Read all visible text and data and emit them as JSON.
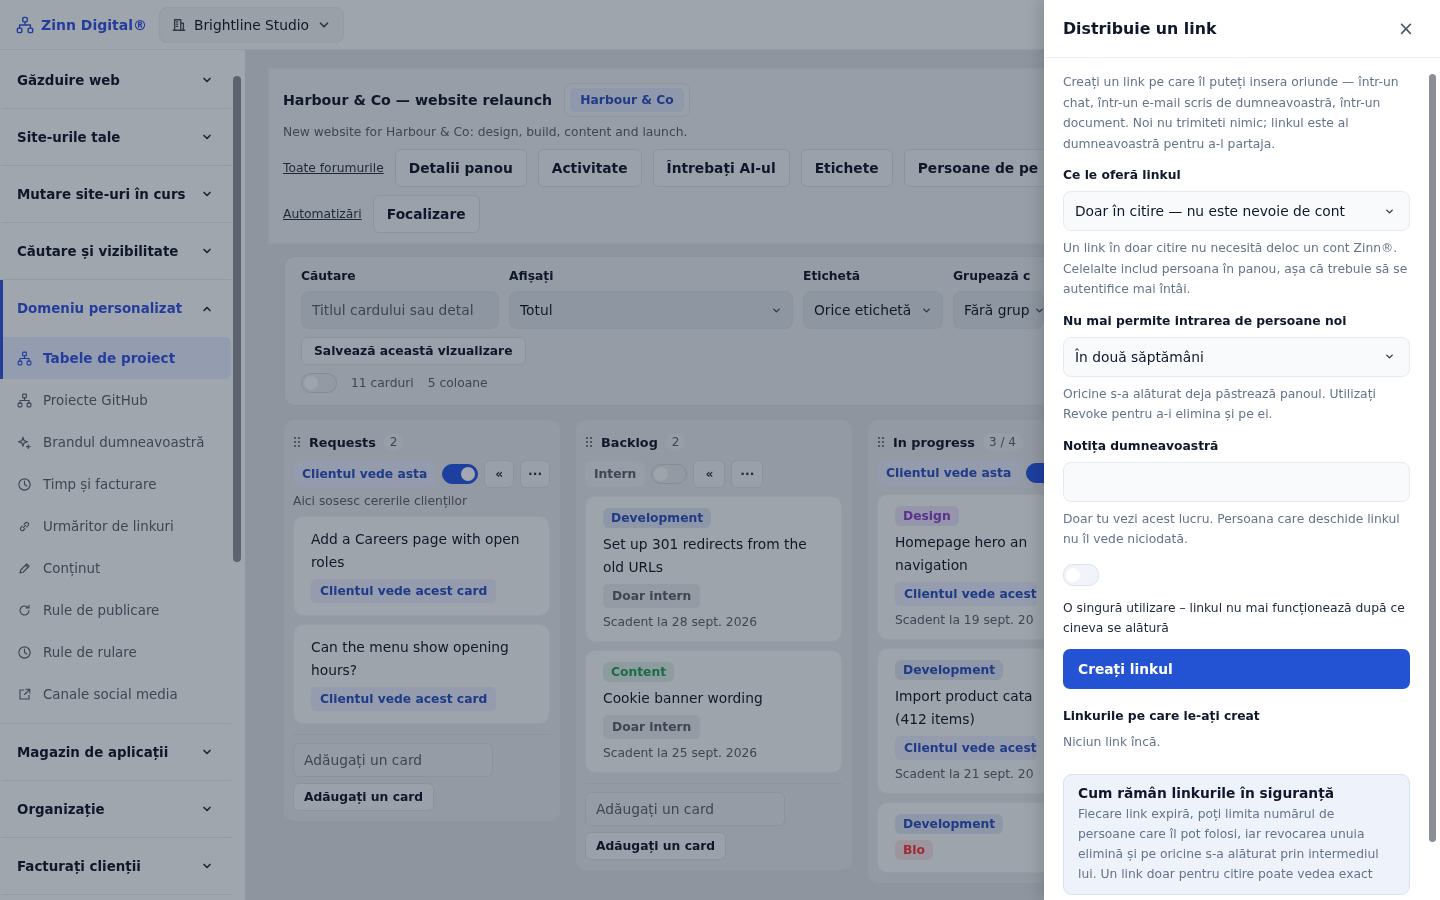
{
  "brand": {
    "name": "Zinn Digital®"
  },
  "workspace": {
    "name": "Brightline Studio"
  },
  "sidebar": {
    "sections": [
      {
        "label": "Găzduire web",
        "expanded": false,
        "selected": false
      },
      {
        "label": "Site-urile tale",
        "expanded": false,
        "selected": false
      },
      {
        "label": "Mutare site-uri în curs",
        "expanded": false,
        "selected": false
      },
      {
        "label": "Căutare și vizibilitate",
        "expanded": false,
        "selected": false
      },
      {
        "label": "Domeniu personalizat",
        "expanded": true,
        "selected": true,
        "children": [
          {
            "label": "Tabele de proiect",
            "selected": true
          },
          {
            "label": "Proiecte GitHub",
            "selected": false
          },
          {
            "label": "Brandul dumneavoastră",
            "selected": false
          },
          {
            "label": "Timp și facturare",
            "selected": false
          },
          {
            "label": "Urmăritor de linkuri",
            "selected": false
          },
          {
            "label": "Conținut",
            "selected": false
          },
          {
            "label": "Rule de publicare",
            "selected": false
          },
          {
            "label": "Rule de rulare",
            "selected": false
          },
          {
            "label": "Canale social media",
            "selected": false
          }
        ]
      },
      {
        "label": "Magazin de aplicații",
        "expanded": false,
        "selected": false
      },
      {
        "label": "Organizație",
        "expanded": false,
        "selected": false
      },
      {
        "label": "Facturați clienții",
        "expanded": false,
        "selected": false
      }
    ]
  },
  "board": {
    "title": "Harbour & Co — website relaunch",
    "client": "Harbour & Co",
    "description": "New website for Harbour & Co: design, build, content and launch.",
    "nav": [
      {
        "kind": "link",
        "label": "Toate forumurile"
      },
      {
        "kind": "button",
        "label": "Detalii panou"
      },
      {
        "kind": "button",
        "label": "Activitate"
      },
      {
        "kind": "button",
        "label": "Întrebați AI-ul"
      },
      {
        "kind": "button",
        "label": "Etichete"
      },
      {
        "kind": "button",
        "label": "Persoane de pe"
      },
      {
        "kind": "link",
        "label": "Automatizări"
      },
      {
        "kind": "button",
        "label": "Focalizare"
      }
    ]
  },
  "filters": {
    "fields": [
      {
        "kind": "input",
        "label": "Căutare",
        "placeholder": "Titlul cardului sau detal"
      },
      {
        "kind": "select",
        "label": "Afișați",
        "value": "Totul"
      },
      {
        "kind": "select",
        "label": "Etichetă",
        "value": "Orice etichetă"
      },
      {
        "kind": "select",
        "label": "Grupează c",
        "value": "Fără grup"
      }
    ],
    "save_button": "Salvează această vizualizare",
    "compact_toggle": {
      "on": false
    },
    "card_count": "11 carduri",
    "column_count": "5 coloane"
  },
  "columns": [
    {
      "title": "Requests",
      "count": "2",
      "visibility": {
        "label": "Clientul vede asta",
        "on": true
      },
      "collapse": "«",
      "menu": "···",
      "description": "Aici sosesc cererile clienților",
      "cards": [
        {
          "title": "Add a Careers page with open roles",
          "visibility": {
            "label": "Clientul vede acest card",
            "client": true
          }
        },
        {
          "title": "Can the menu show opening hours?",
          "visibility": {
            "label": "Clientul vede acest card",
            "client": true
          }
        }
      ],
      "add_placeholder": "Adăugați un card",
      "add_button": "Adăugați un card"
    },
    {
      "title": "Backlog",
      "count": "2",
      "visibility": {
        "label": "Intern",
        "on": false
      },
      "collapse": "«",
      "menu": "···",
      "cards": [
        {
          "tags": [
            {
              "label": "Development",
              "color": "#1f3a86"
            }
          ],
          "title": "Set up 301 redirects from the old URLs",
          "visibility": {
            "label": "Doar intern",
            "client": false
          },
          "due": "Scadent la 28 sept. 2026"
        },
        {
          "tags": [
            {
              "label": "Content",
              "color": "#1c6b45"
            }
          ],
          "title": "Cookie banner wording",
          "visibility": {
            "label": "Doar intern",
            "client": false
          },
          "due": "Scadent la 25 sept. 2026"
        }
      ],
      "add_placeholder": "Adăugați un card",
      "add_button": "Adăugați un card"
    },
    {
      "title": "In progress",
      "count": "3 / 4",
      "visibility": {
        "label": "Clientul vede asta",
        "on": true
      },
      "cards": [
        {
          "tags": [
            {
              "label": "Design",
              "color": "#5b3190"
            }
          ],
          "title": "Homepage hero an navigation",
          "visibility": {
            "label": "Clientul vede acest",
            "client": true
          },
          "due": "Scadent la 19 sept. 20"
        },
        {
          "tags": [
            {
              "label": "Development",
              "color": "#1f3a86"
            }
          ],
          "title": "Import product cata (412 items)",
          "visibility": {
            "label": "Clientul vede acest",
            "client": true
          },
          "due": "Scadent la 21 sept. 20"
        },
        {
          "tags": [
            {
              "label": "Development",
              "color": "#1f3a86"
            },
            {
              "label": "Blo",
              "color": "#9f2a35"
            }
          ]
        }
      ]
    }
  ],
  "drawer": {
    "title": "Distribuie un link",
    "close": "×",
    "intro": "Creați un link pe care îl puteți insera oriunde — într-un chat, într-un e-mail scris de dumneavoastră, într-un document. Noi nu trimiteti nimic; linkul este al dumneavoastră pentru a-l partaja.",
    "fields": [
      {
        "kind": "select",
        "label": "Ce le oferă linkul",
        "value": "Doar în citire — nu este nevoie de cont",
        "help": "Un link în doar citire nu necesită deloc un cont Zinn®. Celelalte includ persoana în panou, așa că trebuie să se autentifice mai întâi."
      },
      {
        "kind": "select",
        "label": "Nu mai permite intrarea de persoane noi",
        "value": "În două săptămâni",
        "help": "Oricine s-a alăturat deja păstrează panoul. Utilizați Revoke pentru a-i elimina și pe ei."
      },
      {
        "kind": "textarea",
        "label": "Notița dumneavoastră",
        "help": "Doar tu vezi acest lucru. Persoana care deschide linkul nu îl vede niciodată."
      },
      {
        "kind": "toggle",
        "on": false,
        "label": "O singură utilizare – linkul nu mai funcționează după ce cineva se alătură"
      }
    ],
    "create_button": "Creați linkul",
    "links_heading": "Linkurile pe care le-ați creat",
    "links_empty": "Niciun link încă.",
    "info": {
      "title": "Cum rămân linkurile în siguranță",
      "text": "Fiecare link expiră, poți limita numărul de persoane care îl pot folosi, iar revocarea unuia elimină și pe oricine s-a alăturat prin intermediul lui. Un link doar pentru citire poate vedea exact"
    }
  }
}
